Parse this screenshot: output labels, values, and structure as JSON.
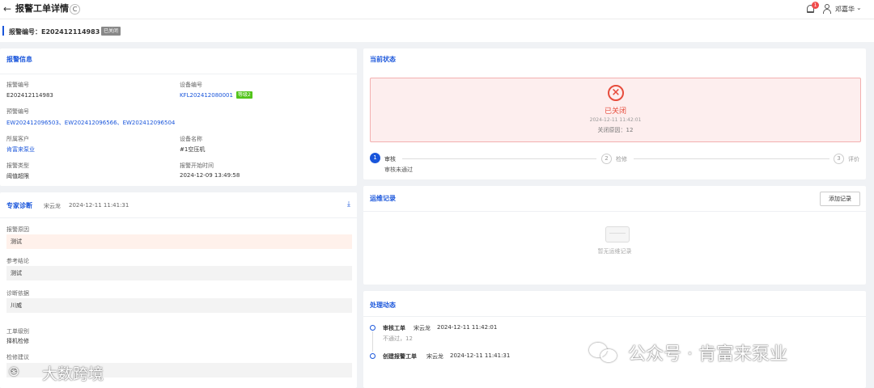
{
  "header": {
    "back_icon": "arrow-left-icon",
    "title": "报警工单详情",
    "refresh_icon": "C",
    "notif_count": "1",
    "user_name": "邓嘉华"
  },
  "subheader": {
    "label": "报警编号：E202412114983",
    "status": "已关闭"
  },
  "alarm_info": {
    "title": "报警信息",
    "alarm_no_label": "报警编号",
    "alarm_no": "E202412114983",
    "device_no_label": "设备编号",
    "device_no": "KFL202412080001",
    "grade": "等级2",
    "warning_no_label": "预警编号",
    "warning_nos": "EW202412096503、EW202412096566、EW202412096504",
    "customer_label": "所属客户",
    "customer": "肯富来泵业",
    "device_name_label": "设备名称",
    "device_name": "#1空压机",
    "type_label": "报警类型",
    "type": "阈值超限",
    "start_time_label": "报警开始时间",
    "start_time": "2024-12-09 13:49:58"
  },
  "diagnosis": {
    "title": "专家诊断",
    "expert": "宋云龙",
    "time": "2024-12-11 11:41:31",
    "cause_label": "报警原因",
    "cause": "测试",
    "conclusion_label": "参考结论",
    "conclusion": "测试",
    "basis_label": "诊断依据",
    "basis": "川威",
    "level_label": "工单级别",
    "level": "择机检修",
    "suggest_label": "检修建议",
    "suggest": "ce"
  },
  "current_status": {
    "title": "当前状态",
    "status": "已关闭",
    "time": "2024-12-11 11:42:01",
    "reason": "关闭原因：12",
    "steps": [
      {
        "num": "1",
        "label": "审核",
        "sub": "审核未通过"
      },
      {
        "num": "2",
        "label": "检修"
      },
      {
        "num": "3",
        "label": "评价"
      }
    ]
  },
  "ops_record": {
    "title": "运维记录",
    "add_button": "添加记录",
    "empty": "暂无运维记录"
  },
  "process": {
    "title": "处理动态",
    "items": [
      {
        "action": "审核工单",
        "user": "宋云龙",
        "time": "2024-12-11 11:42:01",
        "note": "不通过，12"
      },
      {
        "action": "创建报警工单",
        "user": "宋云龙",
        "time": "2024-12-11 11:41:31"
      }
    ]
  },
  "watermarks": {
    "right": "公众号 · 肯富来泵业",
    "left": "大数跨境"
  }
}
